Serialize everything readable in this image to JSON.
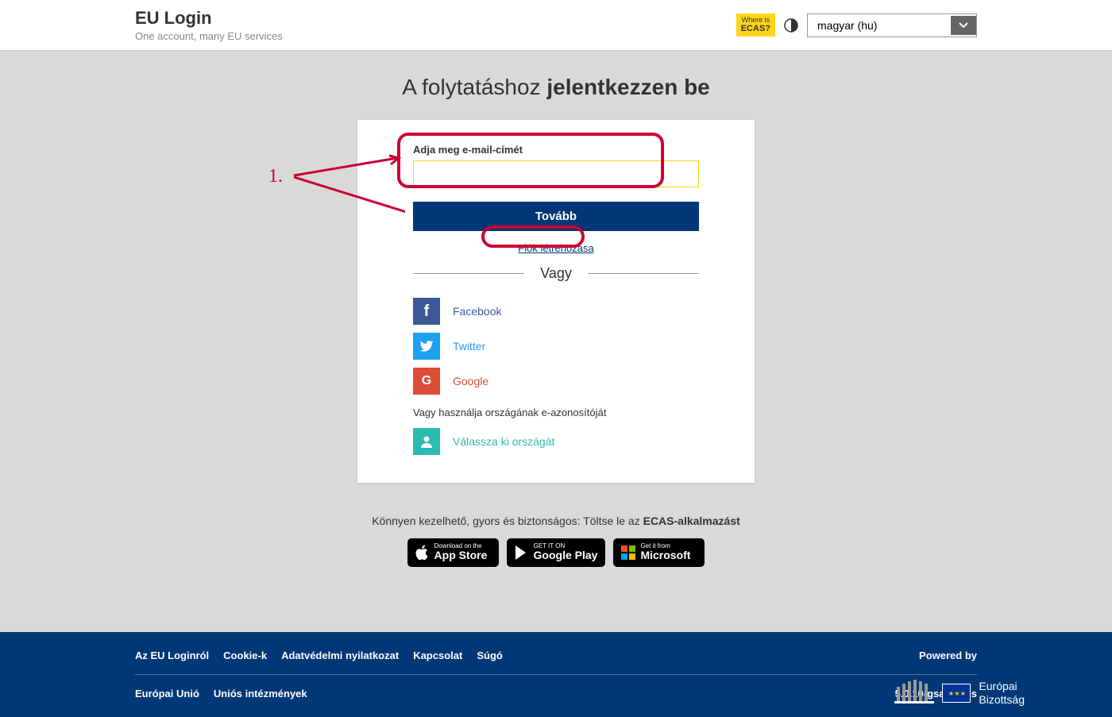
{
  "header": {
    "title": "EU Login",
    "subtitle": "One account, many EU services",
    "ecas_small": "Where is",
    "ecas_big": "ECAS?",
    "language": "magyar (hu)"
  },
  "main": {
    "heading_prefix": "A folytatáshoz ",
    "heading_bold": "jelentkezzen be",
    "email_label": "Adja meg e-mail-címét",
    "email_value": "",
    "next_button": "Tovább",
    "create_account": "Fiók létrehozása",
    "divider": "Vagy",
    "social": {
      "facebook": "Facebook",
      "twitter": "Twitter",
      "google": "Google"
    },
    "eid_text": "Vagy használja országának e-azonosítóját",
    "country_select": "Válassza ki országát"
  },
  "annotation": {
    "number": "1."
  },
  "download": {
    "text_prefix": "Könnyen kezelhető, gyors és biztonságos: Töltse le az ",
    "text_bold": "ECAS-alkalmazást",
    "appstore_small": "Download on the",
    "appstore_big": "App Store",
    "play_small": "GET IT ON",
    "play_big": "Google Play",
    "ms_small": "Get it from",
    "ms_big": "Microsoft"
  },
  "footer": {
    "links1": [
      "Az EU Loginról",
      "Cookie-k",
      "Adatvédelmi nyilatkozat",
      "Kapcsolat",
      "Súgó"
    ],
    "powered": "Powered by",
    "links2": [
      "Európai Unió",
      "Uniós intézmények"
    ],
    "version": "5.0.10-gsa | 4 ms",
    "ec_line1": "Európai",
    "ec_line2": "Bizottság"
  }
}
